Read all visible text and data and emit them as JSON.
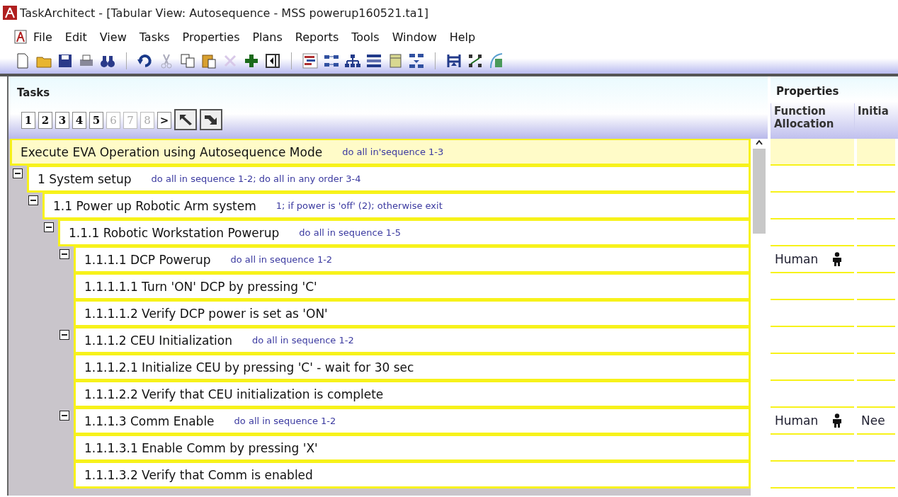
{
  "window": {
    "title": "TaskArchitect - [Tabular View: Autosequence - MSS powerup160521.ta1]"
  },
  "menu": [
    "File",
    "Edit",
    "View",
    "Tasks",
    "Properties",
    "Plans",
    "Reports",
    "Tools",
    "Window",
    "Help"
  ],
  "tasks_panel": {
    "title": "Tasks",
    "pages": [
      {
        "label": "1",
        "disabled": false
      },
      {
        "label": "2",
        "disabled": false
      },
      {
        "label": "3",
        "disabled": false
      },
      {
        "label": "4",
        "disabled": false
      },
      {
        "label": "5",
        "disabled": false
      },
      {
        "label": "6",
        "disabled": true
      },
      {
        "label": "7",
        "disabled": true
      },
      {
        "label": "8",
        "disabled": true
      },
      {
        "label": ">",
        "disabled": false
      }
    ],
    "tree": {
      "label": "Execute EVA Operation using Autosequence Mode",
      "plan": "do all in'sequence 1-3",
      "children": [
        {
          "label": "1 System setup",
          "plan": "do all in sequence 1-2; do all in any order 3-4",
          "expanded": true,
          "children": [
            {
              "label": "1.1 Power up Robotic Arm system",
              "plan": "1; if power is 'off' (2); otherwise exit",
              "expanded": true,
              "children": [
                {
                  "label": "1.1.1 Robotic Workstation Powerup",
                  "plan": "do all in sequence 1-5",
                  "expanded": true,
                  "children": [
                    {
                      "label": "1.1.1.1 DCP Powerup",
                      "plan": "do all in sequence 1-2",
                      "expanded": true,
                      "function_allocation": "Human",
                      "children": [
                        {
                          "label": "1.1.1.1.1 Turn 'ON' DCP by pressing 'C'"
                        },
                        {
                          "label": "1.1.1.1.2 Verify DCP power is set as 'ON'"
                        }
                      ]
                    },
                    {
                      "label": "1.1.1.2 CEU Initialization",
                      "plan": "do all in sequence 1-2",
                      "expanded": true,
                      "children": [
                        {
                          "label": "1.1.1.2.1 Initialize CEU by pressing 'C' - wait for 30 sec"
                        },
                        {
                          "label": "1.1.1.2.2 Verify that CEU initialization is complete"
                        }
                      ]
                    },
                    {
                      "label": "1.1.1.3 Comm Enable",
                      "plan": "do all in sequence 1-2",
                      "expanded": true,
                      "function_allocation": "Human",
                      "column_2": "Nee",
                      "children": [
                        {
                          "label": "1.1.1.3.1 Enable Comm by pressing 'X'"
                        },
                        {
                          "label": "1.1.1.3.2 Verify that Comm is enabled"
                        }
                      ]
                    }
                  ]
                }
              ]
            }
          ]
        }
      ]
    }
  },
  "properties_panel": {
    "title": "Properties",
    "columns": [
      "Function Allocation",
      "Initia"
    ]
  }
}
